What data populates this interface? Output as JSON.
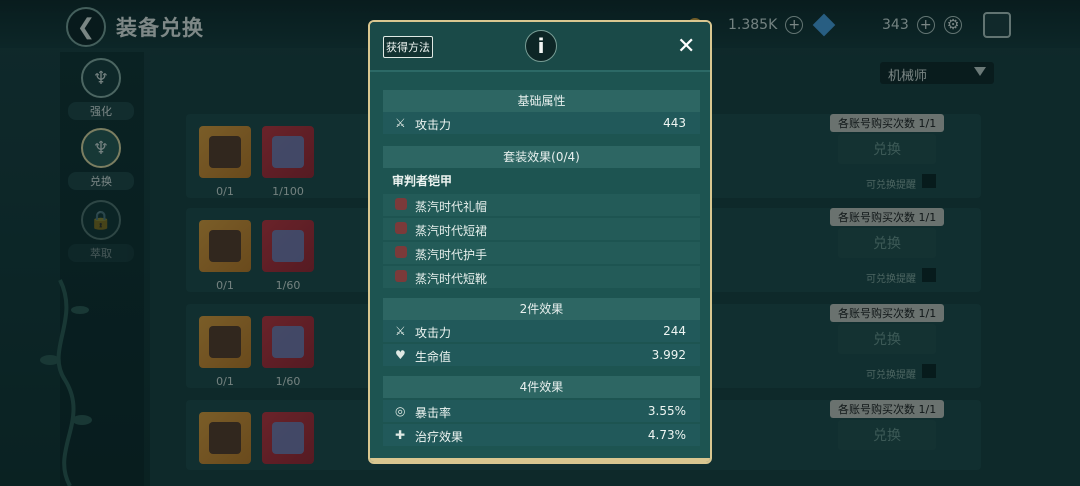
{
  "header": {
    "title": "装备兑换",
    "back_icon": "back-arrow-icon"
  },
  "resources": [
    {
      "name": "gold",
      "value": "1.385K",
      "icon": "coin-icon"
    },
    {
      "name": "diamond",
      "value": "343",
      "icon": "diamond-icon"
    }
  ],
  "sidebar": {
    "items": [
      {
        "label": "强化",
        "icon": "trident-icon"
      },
      {
        "label": "兑换",
        "icon": "trident-icon"
      },
      {
        "label": "萃取",
        "icon": "lock-icon"
      }
    ]
  },
  "class_select": {
    "value": "机械师"
  },
  "rows": [
    {
      "owned": "0/1",
      "fragments": "1/100",
      "limit": "各账号购买次数 1/1",
      "button": "兑换",
      "remind": "可兑换提醒"
    },
    {
      "owned": "0/1",
      "fragments": "1/60",
      "limit": "各账号购买次数 1/1",
      "button": "兑换",
      "remind": "可兑换提醒"
    },
    {
      "owned": "0/1",
      "fragments": "1/60",
      "limit": "各账号购买次数 1/1",
      "button": "兑换",
      "remind": "可兑换提醒"
    },
    {
      "owned": "",
      "fragments": "",
      "limit": "各账号购买次数 1/1",
      "button": "兑换",
      "remind": ""
    }
  ],
  "modal": {
    "obtain_button": "获得方法",
    "info_icon": "i",
    "close_icon": "✕",
    "base_section": {
      "title": "基础属性",
      "stats": [
        {
          "name": "攻击力",
          "value": "443",
          "icon": "swords-icon"
        }
      ]
    },
    "set_section": {
      "title": "套装效果(0/4)",
      "set_name": "审判者铠甲",
      "pieces": [
        {
          "name": "蒸汽时代礼帽",
          "icon": "hat-icon"
        },
        {
          "name": "蒸汽时代短裙",
          "icon": "skirt-icon"
        },
        {
          "name": "蒸汽时代护手",
          "icon": "gauntlet-icon"
        },
        {
          "name": "蒸汽时代短靴",
          "icon": "boots-icon"
        }
      ]
    },
    "two_piece": {
      "title": "2件效果",
      "stats": [
        {
          "name": "攻击力",
          "value": "244",
          "icon": "swords-icon"
        },
        {
          "name": "生命值",
          "value": "3.992",
          "icon": "heart-icon"
        }
      ]
    },
    "four_piece": {
      "title": "4件效果",
      "stats": [
        {
          "name": "暴击率",
          "value": "3.55%",
          "icon": "crit-icon"
        },
        {
          "name": "治疗效果",
          "value": "4.73%",
          "icon": "heal-icon"
        }
      ]
    }
  }
}
